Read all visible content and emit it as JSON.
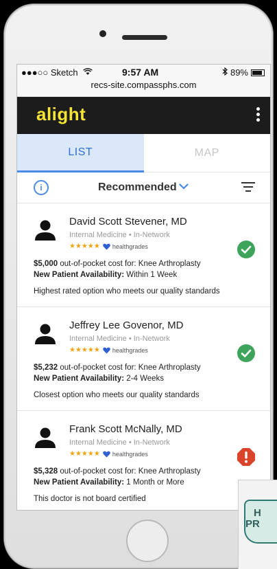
{
  "status_bar": {
    "carrier": "●●●○○ Sketch",
    "time": "9:57 AM",
    "battery": "89%"
  },
  "browser": {
    "url": "recs-site.compassphs.com"
  },
  "app": {
    "logo": "alight",
    "colors": {
      "header_bg": "#1c1c1c",
      "logo": "#f5e433",
      "accent": "#4a8ae8",
      "good": "#3fa45b",
      "warning": "#d9442b"
    }
  },
  "tabs": [
    {
      "label": "LIST",
      "active": true
    },
    {
      "label": "MAP",
      "active": false
    }
  ],
  "sort": {
    "label": "Recommended"
  },
  "providers": [
    {
      "name": "David Scott Stevener, MD",
      "specialty": "Internal Medicine • In-Network",
      "stars": "★★★★★",
      "rating_source": "healthgrades",
      "cost_amount": "$5,000",
      "cost_text": " out-of-pocket cost for: Knee Arthroplasty",
      "availability_label": "New Patient Availability:",
      "availability_value": " Within 1 Week",
      "note": "Highest rated option who meets our quality standards",
      "status": "check-circle-icon"
    },
    {
      "name": "Jeffrey Lee Govenor, MD",
      "specialty": "Internal Medicine • In-Network",
      "stars": "★★★★★",
      "rating_source": "healthgrades",
      "cost_amount": "$5,232",
      "cost_text": " out-of-pocket cost for: Knee Arthroplasty",
      "availability_label": "New Patient Availability:",
      "availability_value": " 2-4 Weeks",
      "note": "Closest option who meets our quality standards",
      "status": "check-circle-icon"
    },
    {
      "name": "Frank Scott McNally, MD",
      "specialty": "Internal Medicine • In-Network",
      "stars": "★★★★★",
      "rating_source": "healthgrades",
      "cost_amount": "$5,328",
      "cost_text": " out-of-pocket cost for: Knee Arthroplasty",
      "availability_label": "New Patient Availability:",
      "availability_value": " 1 Month or More",
      "note": "This doctor is not board certified",
      "status": "alert-octagon-icon"
    }
  ],
  "overlay": {
    "text_line1": "H",
    "text_line2": "PR"
  }
}
